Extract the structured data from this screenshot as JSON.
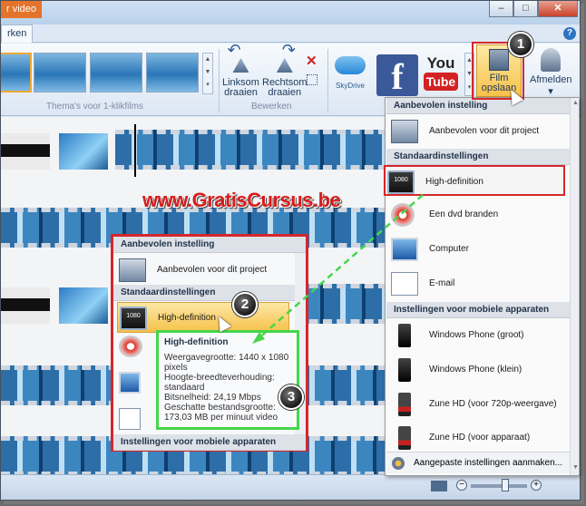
{
  "window": {
    "title": "r video",
    "edit_tab": "rken",
    "help": "?",
    "buttons": {
      "minimize": "–",
      "maximize": "□",
      "close": "✕"
    }
  },
  "ribbon": {
    "themes_group_label": "Thema's voor 1-klikfilms",
    "edit_group_label": "Bewerken",
    "rotate_left": [
      "Linksom",
      "draaien"
    ],
    "rotate_right": [
      "Rechtsom",
      "draaien"
    ],
    "skydrive": "SkyDrive",
    "facebook": "f",
    "youtube_top": "You",
    "youtube_bottom": "Tube",
    "film_save": [
      "Film",
      "opslaan"
    ],
    "afmelden": "Afmelden"
  },
  "watermark": "www.GratisCursus.be",
  "menu": {
    "recommended_header": "Aanbevolen instelling",
    "recommended_item": "Aanbevolen voor dit project",
    "standard_header": "Standaardinstellingen",
    "standard_items": [
      "High-definition",
      "Een dvd branden",
      "Computer",
      "E-mail"
    ],
    "mobile_header": "Instellingen voor mobiele apparaten",
    "mobile_items": [
      "Windows Phone (groot)",
      "Windows Phone (klein)",
      "Zune HD (voor 720p-weergave)",
      "Zune HD (voor apparaat)"
    ],
    "footer": "Aangepaste instellingen aanmaken...",
    "hd_icon_text": "1080"
  },
  "callout": {
    "recommended_header": "Aanbevolen instelling",
    "recommended_item": "Aanbevolen voor dit project",
    "standard_header": "Standaardinstellingen",
    "hd_item": "High-definition",
    "mobile_header": "Instellingen voor mobiele apparaten"
  },
  "tooltip": {
    "title": "High-definition",
    "lines": [
      "Weergavegrootte: 1440 x 1080",
      "pixels",
      "Hoogte-breedteverhouding:",
      "standaard",
      "Bitsnelheid: 24,19 Mbps",
      "Geschatte bestandsgrootte:",
      "173,03 MB per minuut video"
    ]
  },
  "badges": [
    "1",
    "2",
    "3"
  ],
  "colors": {
    "annotation_red": "#d6262a",
    "annotation_green": "#45d64b",
    "selection_orange": "#f6c14a"
  }
}
